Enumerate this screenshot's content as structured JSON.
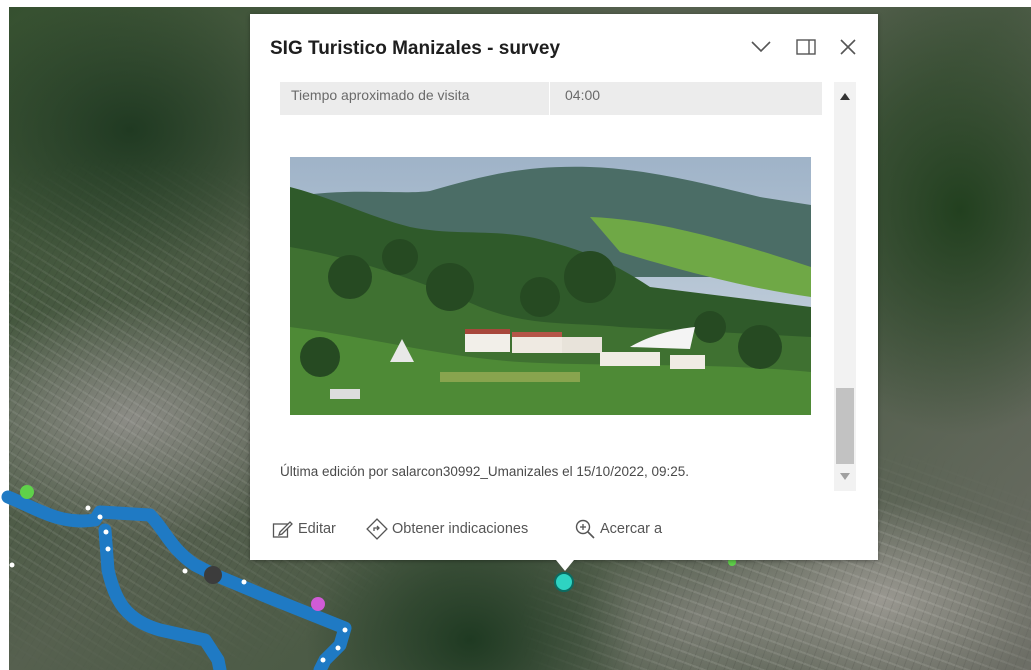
{
  "popup": {
    "title": "SIG Turistico Manizales - survey",
    "controls": {
      "collapse_icon": "chevron-down-icon",
      "dock_icon": "dock-icon",
      "close_icon": "close-icon"
    },
    "attribute": {
      "label": "Tiempo aproximado de visita",
      "value": "04:00"
    },
    "photo": {
      "description_icon": "landscape-photo"
    },
    "last_edit": "Última edición por salarcon30992_Umanizales el 15/10/2022, 09:25.",
    "actions": [
      {
        "label": "Editar",
        "icon": "edit-icon"
      },
      {
        "label": "Obtener indicaciones",
        "icon": "directions-icon"
      },
      {
        "label": "Acercar a",
        "icon": "zoom-in-icon"
      }
    ]
  },
  "map": {
    "route_color": "#1f7ac4",
    "markers": [
      {
        "name": "green-marker",
        "color": "#5fd14a"
      },
      {
        "name": "dark-marker",
        "color": "#3c3c3c"
      },
      {
        "name": "magenta-marker",
        "color": "#d05bd6"
      },
      {
        "name": "selected-marker",
        "color": "#2ed3c2"
      }
    ]
  }
}
